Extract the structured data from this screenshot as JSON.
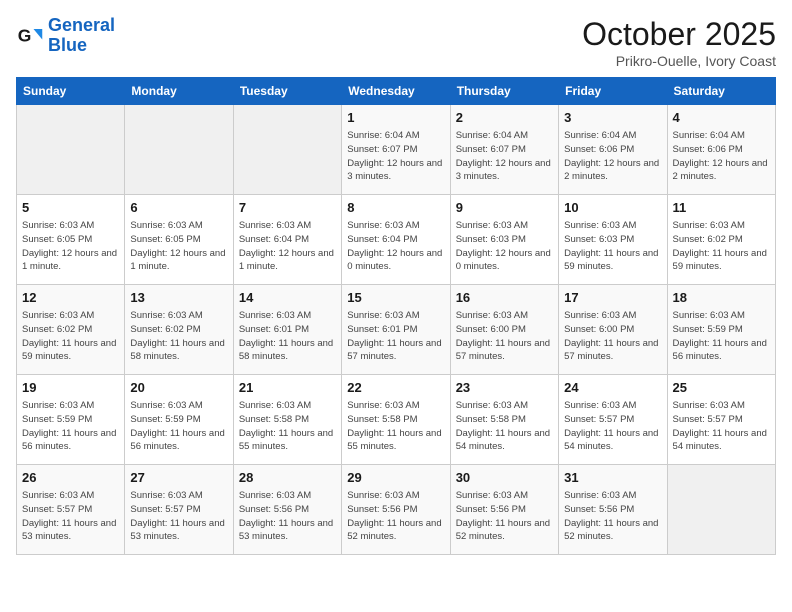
{
  "header": {
    "logo_line1": "General",
    "logo_line2": "Blue",
    "month": "October 2025",
    "location": "Prikro-Ouelle, Ivory Coast"
  },
  "weekdays": [
    "Sunday",
    "Monday",
    "Tuesday",
    "Wednesday",
    "Thursday",
    "Friday",
    "Saturday"
  ],
  "weeks": [
    [
      {
        "day": "",
        "info": ""
      },
      {
        "day": "",
        "info": ""
      },
      {
        "day": "",
        "info": ""
      },
      {
        "day": "1",
        "info": "Sunrise: 6:04 AM\nSunset: 6:07 PM\nDaylight: 12 hours and 3 minutes."
      },
      {
        "day": "2",
        "info": "Sunrise: 6:04 AM\nSunset: 6:07 PM\nDaylight: 12 hours and 3 minutes."
      },
      {
        "day": "3",
        "info": "Sunrise: 6:04 AM\nSunset: 6:06 PM\nDaylight: 12 hours and 2 minutes."
      },
      {
        "day": "4",
        "info": "Sunrise: 6:04 AM\nSunset: 6:06 PM\nDaylight: 12 hours and 2 minutes."
      }
    ],
    [
      {
        "day": "5",
        "info": "Sunrise: 6:03 AM\nSunset: 6:05 PM\nDaylight: 12 hours and 1 minute."
      },
      {
        "day": "6",
        "info": "Sunrise: 6:03 AM\nSunset: 6:05 PM\nDaylight: 12 hours and 1 minute."
      },
      {
        "day": "7",
        "info": "Sunrise: 6:03 AM\nSunset: 6:04 PM\nDaylight: 12 hours and 1 minute."
      },
      {
        "day": "8",
        "info": "Sunrise: 6:03 AM\nSunset: 6:04 PM\nDaylight: 12 hours and 0 minutes."
      },
      {
        "day": "9",
        "info": "Sunrise: 6:03 AM\nSunset: 6:03 PM\nDaylight: 12 hours and 0 minutes."
      },
      {
        "day": "10",
        "info": "Sunrise: 6:03 AM\nSunset: 6:03 PM\nDaylight: 11 hours and 59 minutes."
      },
      {
        "day": "11",
        "info": "Sunrise: 6:03 AM\nSunset: 6:02 PM\nDaylight: 11 hours and 59 minutes."
      }
    ],
    [
      {
        "day": "12",
        "info": "Sunrise: 6:03 AM\nSunset: 6:02 PM\nDaylight: 11 hours and 59 minutes."
      },
      {
        "day": "13",
        "info": "Sunrise: 6:03 AM\nSunset: 6:02 PM\nDaylight: 11 hours and 58 minutes."
      },
      {
        "day": "14",
        "info": "Sunrise: 6:03 AM\nSunset: 6:01 PM\nDaylight: 11 hours and 58 minutes."
      },
      {
        "day": "15",
        "info": "Sunrise: 6:03 AM\nSunset: 6:01 PM\nDaylight: 11 hours and 57 minutes."
      },
      {
        "day": "16",
        "info": "Sunrise: 6:03 AM\nSunset: 6:00 PM\nDaylight: 11 hours and 57 minutes."
      },
      {
        "day": "17",
        "info": "Sunrise: 6:03 AM\nSunset: 6:00 PM\nDaylight: 11 hours and 57 minutes."
      },
      {
        "day": "18",
        "info": "Sunrise: 6:03 AM\nSunset: 5:59 PM\nDaylight: 11 hours and 56 minutes."
      }
    ],
    [
      {
        "day": "19",
        "info": "Sunrise: 6:03 AM\nSunset: 5:59 PM\nDaylight: 11 hours and 56 minutes."
      },
      {
        "day": "20",
        "info": "Sunrise: 6:03 AM\nSunset: 5:59 PM\nDaylight: 11 hours and 56 minutes."
      },
      {
        "day": "21",
        "info": "Sunrise: 6:03 AM\nSunset: 5:58 PM\nDaylight: 11 hours and 55 minutes."
      },
      {
        "day": "22",
        "info": "Sunrise: 6:03 AM\nSunset: 5:58 PM\nDaylight: 11 hours and 55 minutes."
      },
      {
        "day": "23",
        "info": "Sunrise: 6:03 AM\nSunset: 5:58 PM\nDaylight: 11 hours and 54 minutes."
      },
      {
        "day": "24",
        "info": "Sunrise: 6:03 AM\nSunset: 5:57 PM\nDaylight: 11 hours and 54 minutes."
      },
      {
        "day": "25",
        "info": "Sunrise: 6:03 AM\nSunset: 5:57 PM\nDaylight: 11 hours and 54 minutes."
      }
    ],
    [
      {
        "day": "26",
        "info": "Sunrise: 6:03 AM\nSunset: 5:57 PM\nDaylight: 11 hours and 53 minutes."
      },
      {
        "day": "27",
        "info": "Sunrise: 6:03 AM\nSunset: 5:57 PM\nDaylight: 11 hours and 53 minutes."
      },
      {
        "day": "28",
        "info": "Sunrise: 6:03 AM\nSunset: 5:56 PM\nDaylight: 11 hours and 53 minutes."
      },
      {
        "day": "29",
        "info": "Sunrise: 6:03 AM\nSunset: 5:56 PM\nDaylight: 11 hours and 52 minutes."
      },
      {
        "day": "30",
        "info": "Sunrise: 6:03 AM\nSunset: 5:56 PM\nDaylight: 11 hours and 52 minutes."
      },
      {
        "day": "31",
        "info": "Sunrise: 6:03 AM\nSunset: 5:56 PM\nDaylight: 11 hours and 52 minutes."
      },
      {
        "day": "",
        "info": ""
      }
    ]
  ]
}
